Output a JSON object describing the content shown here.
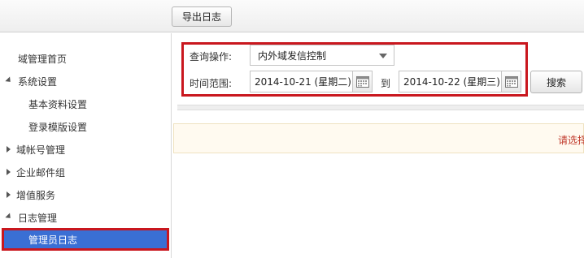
{
  "toolbar": {
    "export_label": "导出日志"
  },
  "sidebar": {
    "items": [
      {
        "label": "域管理首页",
        "indent": 0,
        "arrow": "none"
      },
      {
        "label": "系统设置",
        "indent": 0,
        "arrow": "down"
      },
      {
        "label": "基本资料设置",
        "indent": 1,
        "arrow": "none"
      },
      {
        "label": "登录模版设置",
        "indent": 1,
        "arrow": "none"
      },
      {
        "label": "域帐号管理",
        "indent": 0,
        "arrow": "right"
      },
      {
        "label": "企业邮件组",
        "indent": 0,
        "arrow": "right"
      },
      {
        "label": "增值服务",
        "indent": 0,
        "arrow": "right"
      },
      {
        "label": "日志管理",
        "indent": 0,
        "arrow": "down"
      },
      {
        "label": "管理员日志",
        "indent": 1,
        "arrow": "none",
        "active": true
      }
    ]
  },
  "filter": {
    "operation_label": "查询操作:",
    "operation_value": "内外域发信控制",
    "range_label": "时间范围:",
    "date_from": "2014-10-21 (星期二)",
    "to_label": "到",
    "date_to": "2014-10-22 (星期三)",
    "search_label": "搜索"
  },
  "notice": {
    "text": "请选择"
  },
  "colors": {
    "highlight_border": "#c9171e",
    "active_bg": "#3a6fd4",
    "notice_text": "#c0392b"
  }
}
